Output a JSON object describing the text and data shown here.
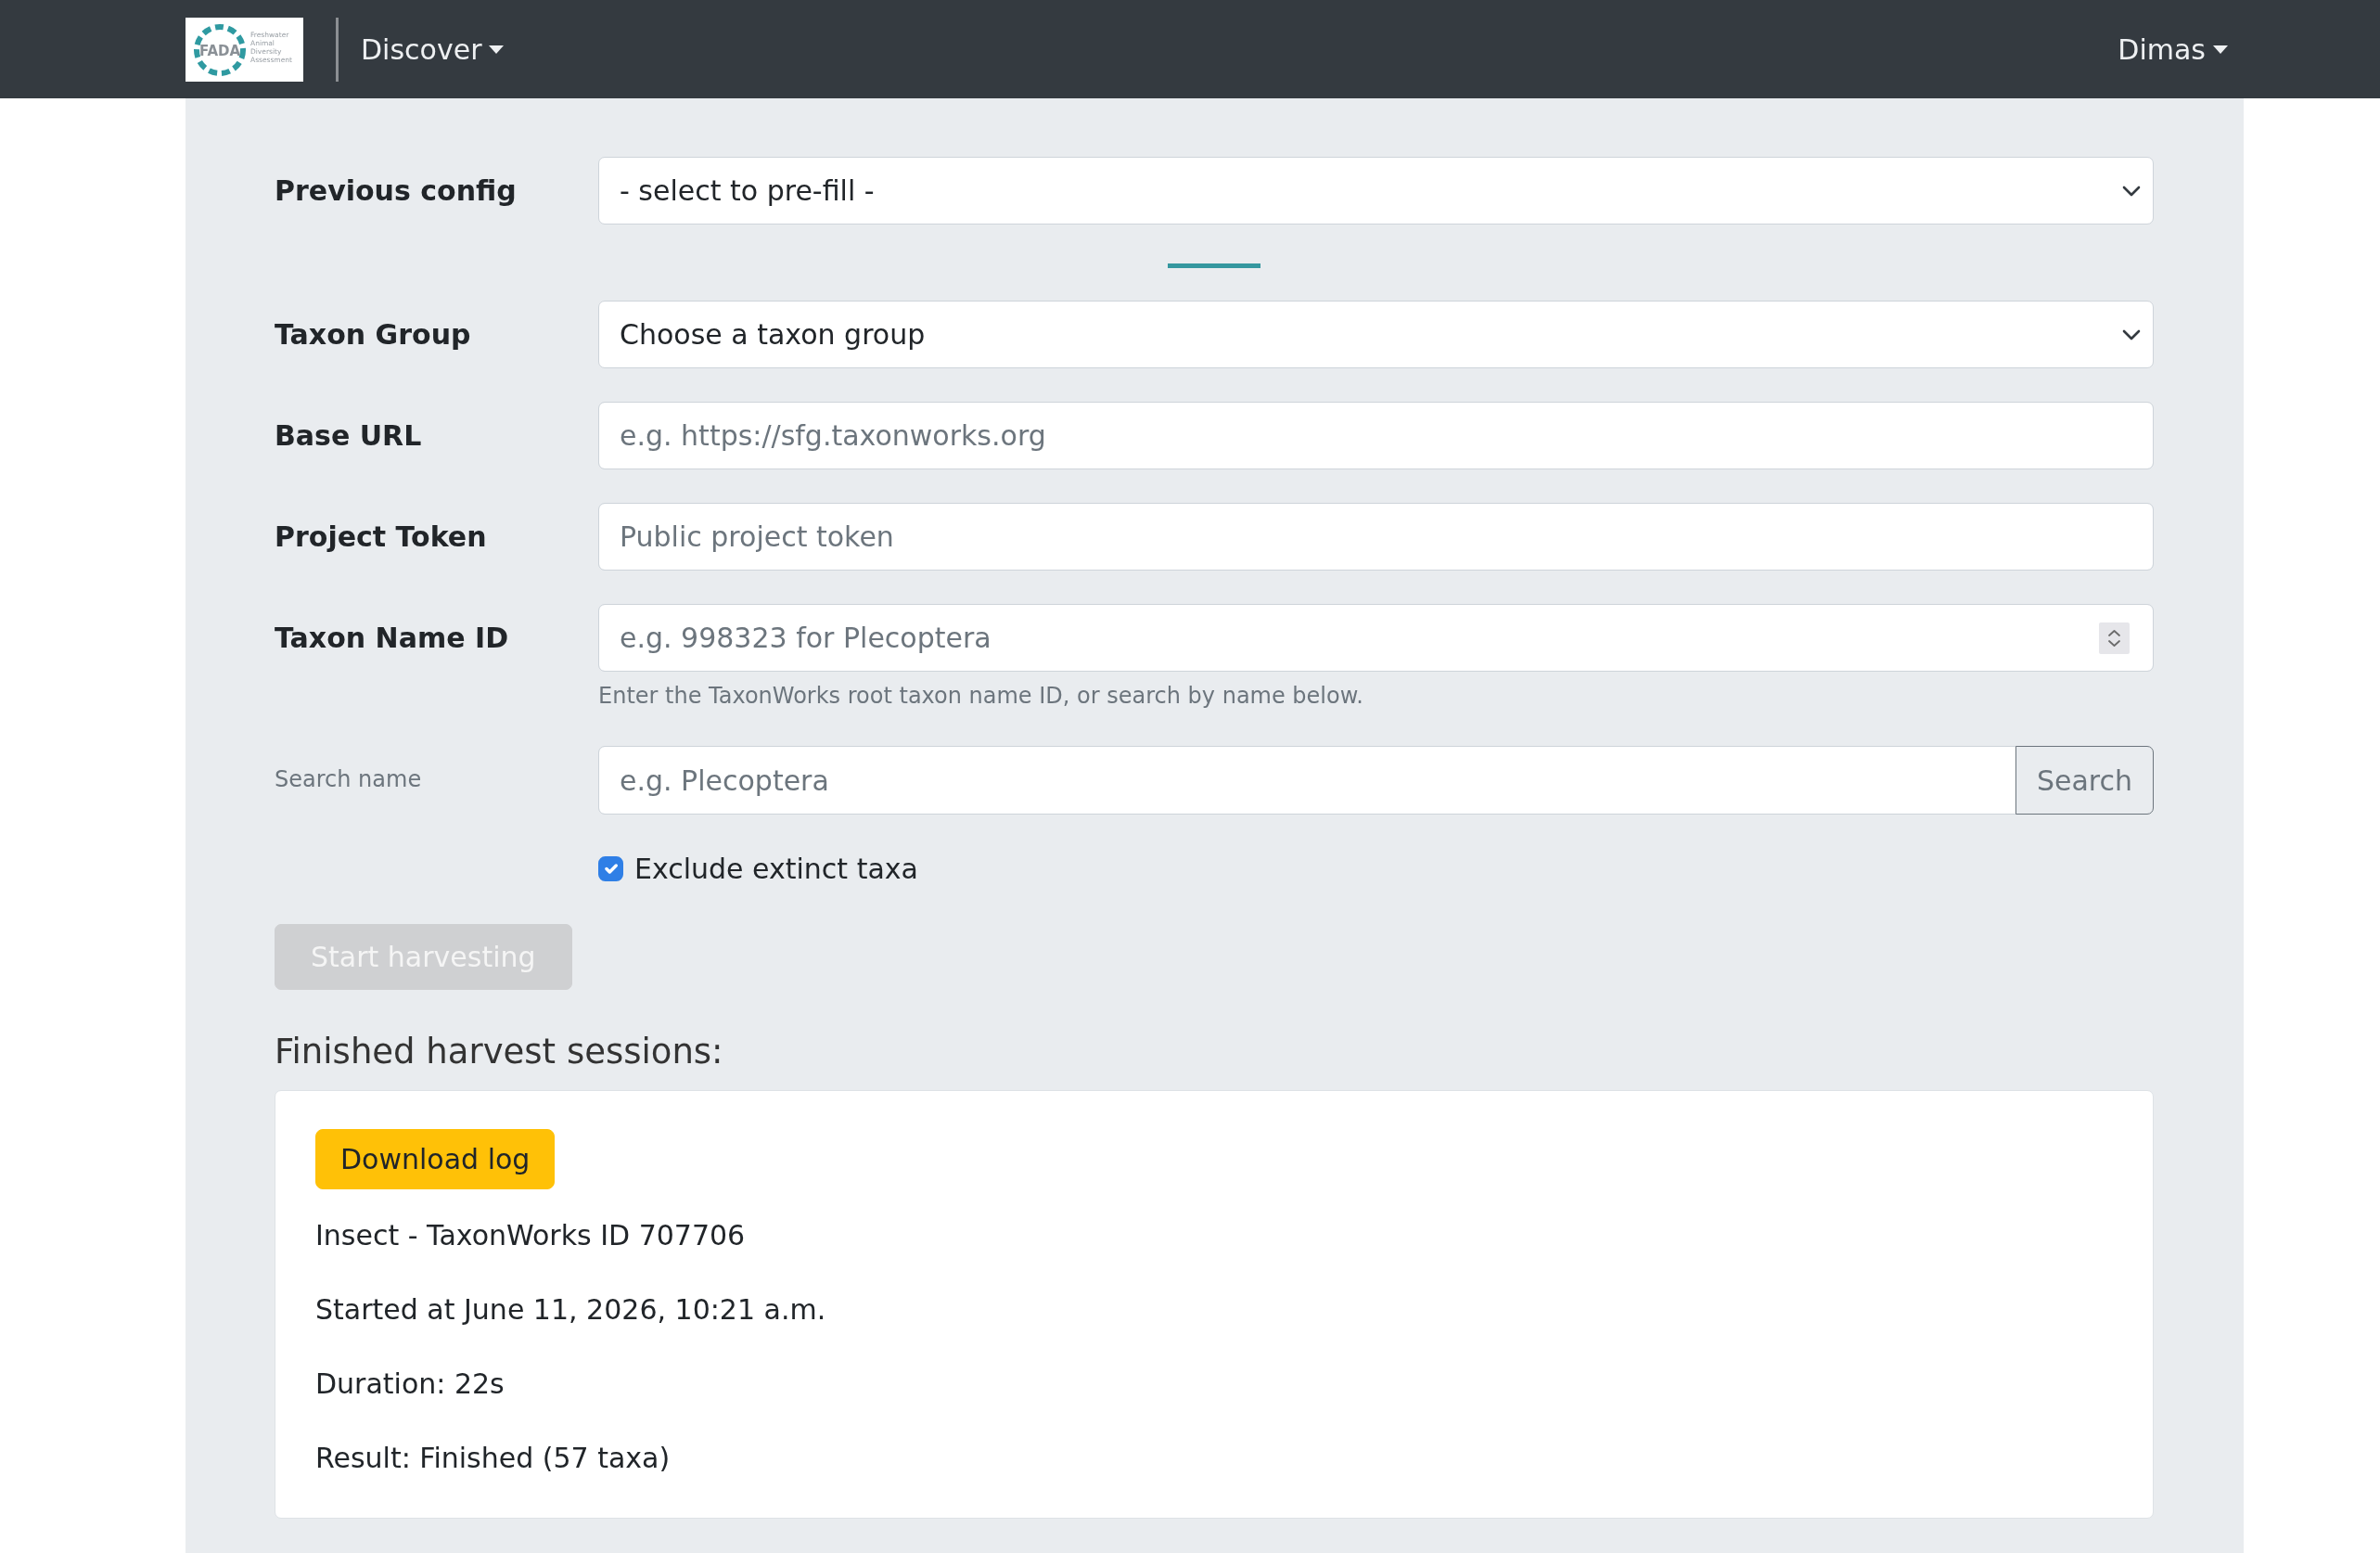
{
  "navbar": {
    "logo": {
      "text": "FADA",
      "tagline": [
        "Freshwater",
        "Animal",
        "Diversity",
        "Assessment"
      ]
    },
    "menus": [
      {
        "label": "Discover"
      }
    ],
    "user_menu": {
      "label": "Dimas"
    }
  },
  "form": {
    "preset": {
      "kind": "select",
      "label": "Previous config",
      "value": "- select to pre-fill -"
    },
    "fields": [
      {
        "kind": "select",
        "label": "Taxon Group",
        "value": "Choose a taxon group"
      },
      {
        "kind": "text",
        "label": "Base URL",
        "placeholder": "e.g. https://sfg.taxonworks.org"
      },
      {
        "kind": "text",
        "label": "Project Token",
        "placeholder": "Public project token"
      },
      {
        "kind": "number",
        "label": "Taxon Name ID",
        "placeholder": "e.g. 998323 for Plecoptera",
        "help": "Enter the TaxonWorks root taxon name ID, or search by name below."
      },
      {
        "kind": "search",
        "label": "Search name",
        "placeholder": "e.g. Plecoptera",
        "button": "Search"
      },
      {
        "kind": "checkbox",
        "label": "Exclude extinct taxa",
        "checked": true
      }
    ],
    "submit": {
      "label": "Start harvesting",
      "disabled": true
    }
  },
  "sessions": {
    "title": "Finished harvest sessions:",
    "items": [
      {
        "action": "Download log",
        "lines": [
          "Insect - TaxonWorks ID 707706",
          "Started at June 11, 2026, 10:21 a.m.",
          "Duration: 22s",
          "Result: Finished (57 taxa)"
        ]
      }
    ]
  }
}
